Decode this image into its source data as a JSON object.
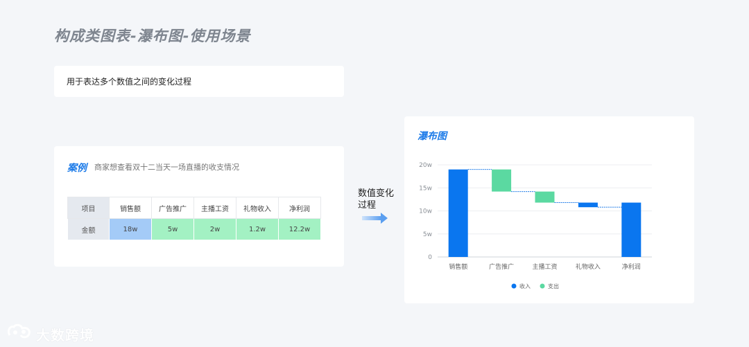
{
  "page_title": "构成类图表-瀑布图-使用场景",
  "description": "用于表达多个数值之间的变化过程",
  "case": {
    "title": "案例",
    "description": "商家想查看双十二当天一场直播的收支情况",
    "table": {
      "row_header_items": "项目",
      "row_header_values": "金额",
      "columns": [
        "销售额",
        "广告推广",
        "主播工资",
        "礼物收入",
        "净利润"
      ],
      "values": [
        "18w",
        "5w",
        "2w",
        "1.2w",
        "12.2w"
      ]
    }
  },
  "arrow_label": "数值变化过程",
  "colors": {
    "income": "#0a76ef",
    "expense": "#5bd9a1",
    "accent": "#1d7be8"
  },
  "chart_title": "瀑布图",
  "chart_data": {
    "type": "bar",
    "subtype": "waterfall",
    "categories": [
      "销售额",
      "广告推广",
      "主播工资",
      "礼物收入",
      "净利润"
    ],
    "bars": [
      {
        "category": "销售额",
        "start": 0,
        "end": 19,
        "kind": "收入"
      },
      {
        "category": "广告推广",
        "start": 19,
        "end": 14.2,
        "kind": "支出"
      },
      {
        "category": "主播工资",
        "start": 14.2,
        "end": 11.8,
        "kind": "支出"
      },
      {
        "category": "礼物收入",
        "start": 11.8,
        "end": 10.8,
        "kind": "收入"
      },
      {
        "category": "净利润",
        "start": 0,
        "end": 11.8,
        "kind": "收入"
      }
    ],
    "ylim": [
      0,
      20
    ],
    "yticks": [
      0,
      5,
      10,
      15,
      20
    ],
    "ytick_labels": [
      "0",
      "5w",
      "10w",
      "15w",
      "20w"
    ],
    "legend": [
      {
        "name": "收入",
        "color": "#0a76ef"
      },
      {
        "name": "支出",
        "color": "#5bd9a1"
      }
    ],
    "legend_position": "bottom-center",
    "grid": true
  },
  "watermark": "大数跨境"
}
